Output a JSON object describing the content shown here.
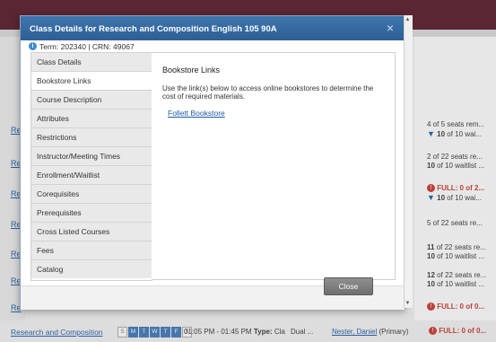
{
  "background": {
    "row_links": [
      "Re",
      "Re",
      "Re",
      "Re",
      "Re",
      "Re",
      "Re"
    ],
    "seat_rows": [
      {
        "line1": "4 of 5 seats rem...",
        "line2_bold": "10",
        "line2_rest": " of 10 wai...",
        "line2_icon": "triangle-down-icon"
      },
      {
        "line1": "2 of 22 seats re...",
        "line2_bold": "10",
        "line2_rest": " of 10 waitlist ...",
        "line2_icon": ""
      },
      {
        "full": "FULL: 0 of 2...",
        "line2_bold": "10",
        "line2_rest": " of 10 wai...",
        "line2_icon": "triangle-down-icon"
      },
      {
        "line1": "5 of 22 seats re..."
      },
      {
        "line1_bold": "11",
        "line1_rest": " of 22 seats re...",
        "line2_bold": "10",
        "line2_rest": " of 10 waitlist ..."
      },
      {
        "line1_bold": "12",
        "line1_rest": " of 22 seats re...",
        "line2_bold": "10",
        "line2_rest": " of 10 waitlist ..."
      },
      {
        "full": "FULL: 0 of 0..."
      }
    ]
  },
  "dialog": {
    "title": "Class Details for Research and Composition English 105 90A",
    "close_icon": "×",
    "term_text": "Term: 202340 | CRN: 49067",
    "tabs": [
      "Class Details",
      "Bookstore Links",
      "Course Description",
      "Attributes",
      "Restrictions",
      "Instructor/Meeting Times",
      "Enrollment/Waitlist",
      "Corequisites",
      "Prerequisites",
      "Cross Listed Courses",
      "Fees",
      "Catalog"
    ],
    "active_tab": "Bookstore Links",
    "panel": {
      "title": "Bookstore Links",
      "description": "Use the link(s) below to access online bookstores to determine the cost of required materials.",
      "link": "Follett Bookstore"
    },
    "close_button": "Close"
  },
  "bottom_row": {
    "course_link": "Research and Composition",
    "days": [
      "S",
      "M",
      "T",
      "W",
      "T",
      "F",
      "S"
    ],
    "days_active": [
      false,
      true,
      true,
      true,
      true,
      true,
      false
    ],
    "time": "01:05 PM - 01:45 PM",
    "type_label": "Type:",
    "type_value": "Cla",
    "dual": "Dual ...",
    "instructor": "Nester, Daniel",
    "instructor_role": " (Primary)",
    "status": "FULL: 0 of 0..."
  },
  "colors": {
    "topbar": "#5a2634",
    "dialog_title": "#3f75ad",
    "link": "#1d5aa8",
    "full": "#c8352b"
  }
}
